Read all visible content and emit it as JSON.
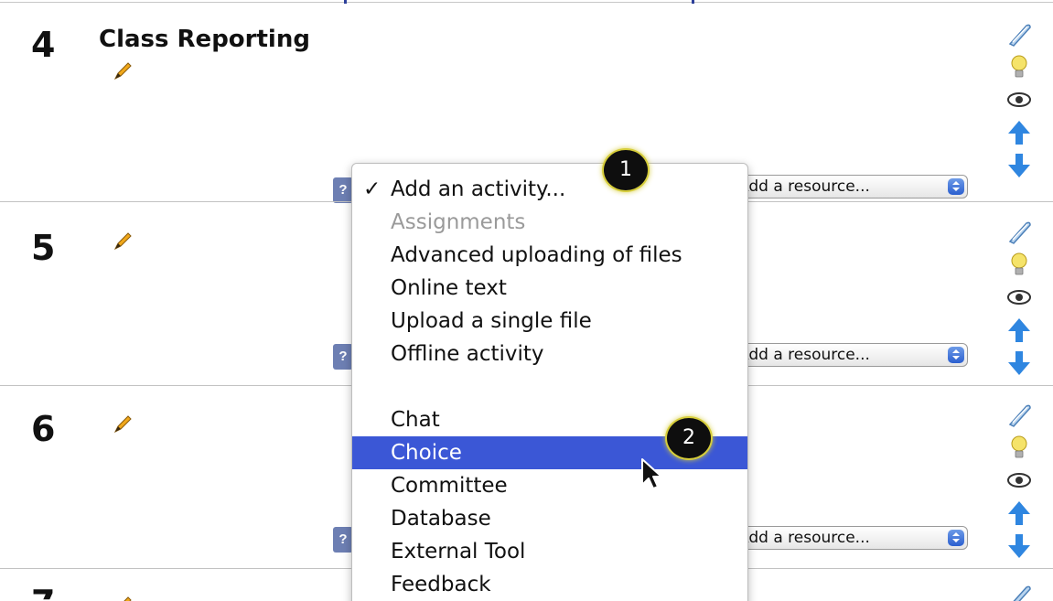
{
  "sections": [
    {
      "number": "4",
      "title": "Class Reporting"
    },
    {
      "number": "5",
      "title": ""
    },
    {
      "number": "6",
      "title": ""
    }
  ],
  "activity_select": {
    "label": "Add an activity..."
  },
  "resource_select": {
    "label": "Add a resource..."
  },
  "section_controls": [
    "edit-icon",
    "highlight-bulb-icon",
    "visibility-eye-icon",
    "move-up-arrow-icon",
    "move-down-arrow-icon"
  ],
  "menu": {
    "items": [
      {
        "label": "Add an activity...",
        "checked": true,
        "check_mark": "✓"
      },
      {
        "label": "Assignments",
        "group_header": true
      },
      {
        "label": "Advanced uploading of files"
      },
      {
        "label": "Online text"
      },
      {
        "label": "Upload a single file"
      },
      {
        "label": "Offline activity"
      },
      {
        "label": "Chat"
      },
      {
        "label": "Choice",
        "highlighted": true
      },
      {
        "label": "Committee"
      },
      {
        "label": "Database"
      },
      {
        "label": "External Tool"
      },
      {
        "label": "Feedback"
      }
    ]
  },
  "callouts": [
    "1",
    "2"
  ],
  "colors": {
    "highlight": "#3b57d6",
    "help_icon": "#6d7fb3",
    "callout_ring": "#d6cd3a",
    "arrow_blue": "#2f86e0"
  }
}
